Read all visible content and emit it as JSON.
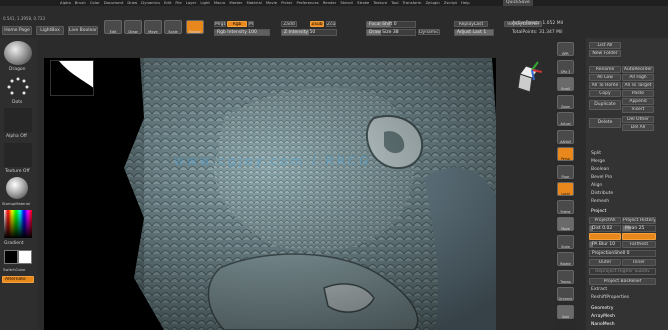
{
  "menubar": {
    "items": [
      "Alpha",
      "Brush",
      "Color",
      "Document",
      "Draw",
      "Dynamics",
      "Edit",
      "File",
      "Layer",
      "Light",
      "Macro",
      "Marker",
      "Material",
      "Movie",
      "Picker",
      "Preferences",
      "Render",
      "Stencil",
      "Stroke",
      "Texture",
      "Tool",
      "Transform",
      "Zplugin",
      "Zscript",
      "Help"
    ],
    "right_label": "QuickSave"
  },
  "status": {
    "line": "0.541, 1.3958, 0.733"
  },
  "toptabs": {
    "home": "Home Page",
    "lightbox": "LightBox",
    "liveboolean": "Live Boolean"
  },
  "toolbar": {
    "edit": "Edit",
    "draw": "Draw",
    "move": "Move",
    "scale": "Scale",
    "rotate": "Rotate",
    "mrgb": "Mrgb",
    "rgb": "Rgb",
    "m": "M",
    "zadd": "Zadd",
    "zsub": "Zsub",
    "zcut": "Zcut",
    "rgb_intensity": "Rgb Intensity",
    "rgb_intensity_value": "100",
    "z_intensity": "Z Intensity",
    "z_intensity_value": "50",
    "focal_shift": "Focal Shift",
    "focal_shift_value": "0",
    "draw_size": "Draw Size",
    "draw_size_value": "38",
    "dynamic": "Dynamic",
    "replay_last": "ReplayLast",
    "replay_last_rel": "ReplayLastRel",
    "adjust_last": "Adjust Last",
    "adjust_last_value": "1",
    "active_points": "ActivePoints: 1.052 Mil",
    "total_points": "TotalPoints: 31.347 Mil"
  },
  "left_shelf": {
    "brush_label": "Dragon",
    "stroke_label": "Dots",
    "alpha_label": "Alpha Off",
    "texture_label": "Texture Off",
    "material_label": "StartupMaterial",
    "gradient_label": "Gradient",
    "switch_color": "SwitchColor",
    "alternate": "Alternate"
  },
  "right_shelf": {
    "buttons": [
      "BPR",
      "SPix 3",
      "Scroll",
      "Zoom",
      "Actual",
      "AAHalf",
      "Persp",
      "Floor",
      "Local",
      "Frame",
      "Move",
      "Scale",
      "Rotate",
      "Transp",
      "Dynamic",
      "Solo"
    ]
  },
  "subtool_panel": {
    "list_all": "List All",
    "new_folder": "New Folder",
    "rename": "Rename",
    "auto_reorder": "AutoReorder",
    "all_low": "All Low",
    "all_high": "All High",
    "all_to_home": "All To Home",
    "all_to_target": "All To Target",
    "copy": "Copy",
    "paste": "Paste",
    "duplicate": "Duplicate",
    "append": "Append",
    "insert": "Insert",
    "delete": "Delete",
    "del_other": "Del Other",
    "del_all": "Del All",
    "split": "Split",
    "merge": "Merge",
    "boolean": "Boolean",
    "bevel_pro": "Bevel Pro",
    "align": "Align",
    "distribute": "Distribute",
    "remesh": "Remesh",
    "project": "Project",
    "projectall": "ProjectAll",
    "project_history": "Project History",
    "dist": "Dist 0.02",
    "mean": "Mean 25",
    "pa_blur": "PA Blur 10",
    "farthest": "Farthest",
    "projection_shell": "ProjectionShell 0",
    "outer": "Outer",
    "inner": "Inner",
    "reproject_higher": "Reproject Higher Subdiv",
    "project_bas_relief": "Project BasRelief",
    "extract": "Extract",
    "reshift_properties": "ReshiftProperties",
    "geometry": "Geometry",
    "arraymesh": "ArrayMesh",
    "nanomesh": "NanoMesh"
  },
  "watermark": "www.cgjoy.com / RRCG"
}
